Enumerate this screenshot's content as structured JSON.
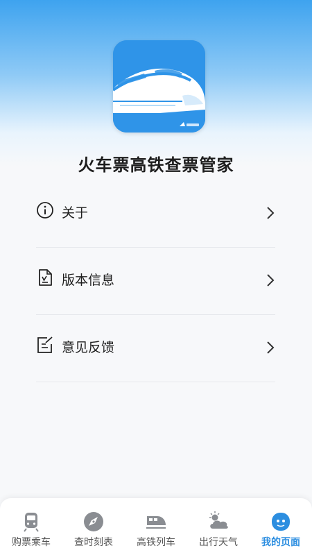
{
  "app": {
    "title": "火车票高铁查票管家"
  },
  "menu": {
    "items": [
      {
        "label": "关于",
        "icon": "info-icon"
      },
      {
        "label": "版本信息",
        "icon": "document-check-icon"
      },
      {
        "label": "意见反馈",
        "icon": "edit-note-icon"
      }
    ]
  },
  "tabbar": {
    "tabs": [
      {
        "label": "购票乘车",
        "icon": "train-front-icon",
        "active": false
      },
      {
        "label": "查时刻表",
        "icon": "compass-icon",
        "active": false
      },
      {
        "label": "高铁列车",
        "icon": "high-speed-train-icon",
        "active": false
      },
      {
        "label": "出行天气",
        "icon": "weather-cloud-sun-icon",
        "active": false
      },
      {
        "label": "我的页面",
        "icon": "profile-face-icon",
        "active": true
      }
    ]
  },
  "colors": {
    "accent": "#2c8ee0",
    "icon_bg": "#2f94e8",
    "tab_icon_gray": "#8a8d92"
  }
}
